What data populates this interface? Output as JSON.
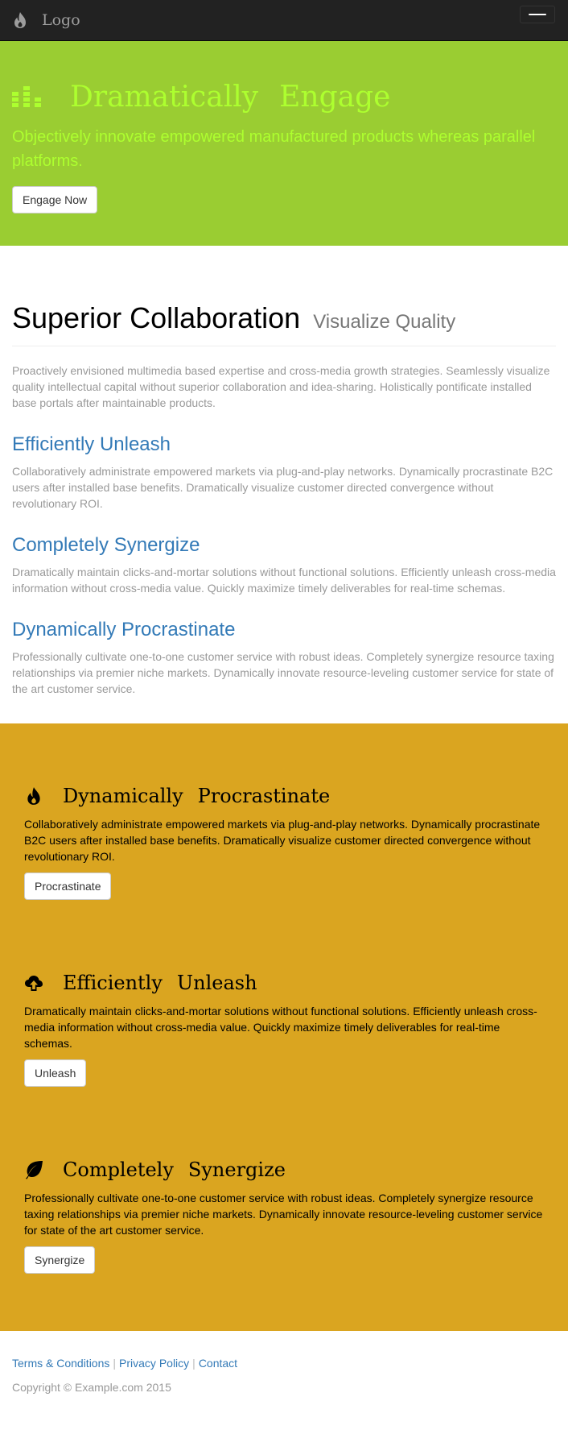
{
  "nav": {
    "brand_icon": "fire-icon",
    "brand_text": "Logo",
    "toggle_icon": "menu-icon"
  },
  "hero": {
    "icon": "equalizer-icon",
    "title_word1": "Dramatically",
    "title_word2": "Engage",
    "subtitle": "Objectively innovate empowered manufactured products whereas parallel platforms.",
    "button_label": "Engage Now",
    "colors": {
      "background": "#9acd32",
      "text": "#adff2f"
    }
  },
  "main": {
    "heading": "Superior Collaboration",
    "heading_small": "Visualize Quality",
    "lead": "Proactively envisioned multimedia based expertise and cross-media growth strategies. Seamlessly visualize quality intellectual capital without superior collaboration and idea-sharing. Holistically pontificate installed base portals after maintainable products.",
    "features": [
      {
        "title": "Efficiently Unleash",
        "text": "Collaboratively administrate empowered markets via plug-and-play networks. Dynamically procrastinate B2C users after installed base benefits. Dramatically visualize customer directed convergence without revolutionary ROI."
      },
      {
        "title": "Completely Synergize",
        "text": "Dramatically maintain clicks-and-mortar solutions without functional solutions. Efficiently unleash cross-media information without cross-media value. Quickly maximize timely deliverables for real-time schemas."
      },
      {
        "title": "Dynamically Procrastinate",
        "text": "Professionally cultivate one-to-one customer service with robust ideas. Completely synergize resource taxing relationships via premier niche markets. Dynamically innovate resource-leveling customer service for state of the art customer service."
      }
    ]
  },
  "gold": {
    "background": "#daa520",
    "items": [
      {
        "icon": "fire-icon",
        "title_word1": "Dynamically",
        "title_word2": "Procrastinate",
        "text": "Collaboratively administrate empowered markets via plug-and-play networks. Dynamically procrastinate B2C users after installed base benefits. Dramatically visualize customer directed convergence without revolutionary ROI.",
        "button_label": "Procrastinate"
      },
      {
        "icon": "cloud-upload-icon",
        "title_word1": "Efficiently",
        "title_word2": "Unleash",
        "text": "Dramatically maintain clicks-and-mortar solutions without functional solutions. Efficiently unleash cross-media information without cross-media value. Quickly maximize timely deliverables for real-time schemas.",
        "button_label": "Unleash"
      },
      {
        "icon": "leaf-icon",
        "title_word1": "Completely",
        "title_word2": "Synergize",
        "text": "Professionally cultivate one-to-one customer service with robust ideas. Completely synergize resource taxing relationships via premier niche markets. Dynamically innovate resource-leveling customer service for state of the art customer service.",
        "button_label": "Synergize"
      }
    ]
  },
  "footer": {
    "links": [
      "Terms & Conditions",
      "Privacy Policy",
      "Contact"
    ],
    "separator": "|",
    "copyright": "Copyright © Example.com 2015"
  }
}
